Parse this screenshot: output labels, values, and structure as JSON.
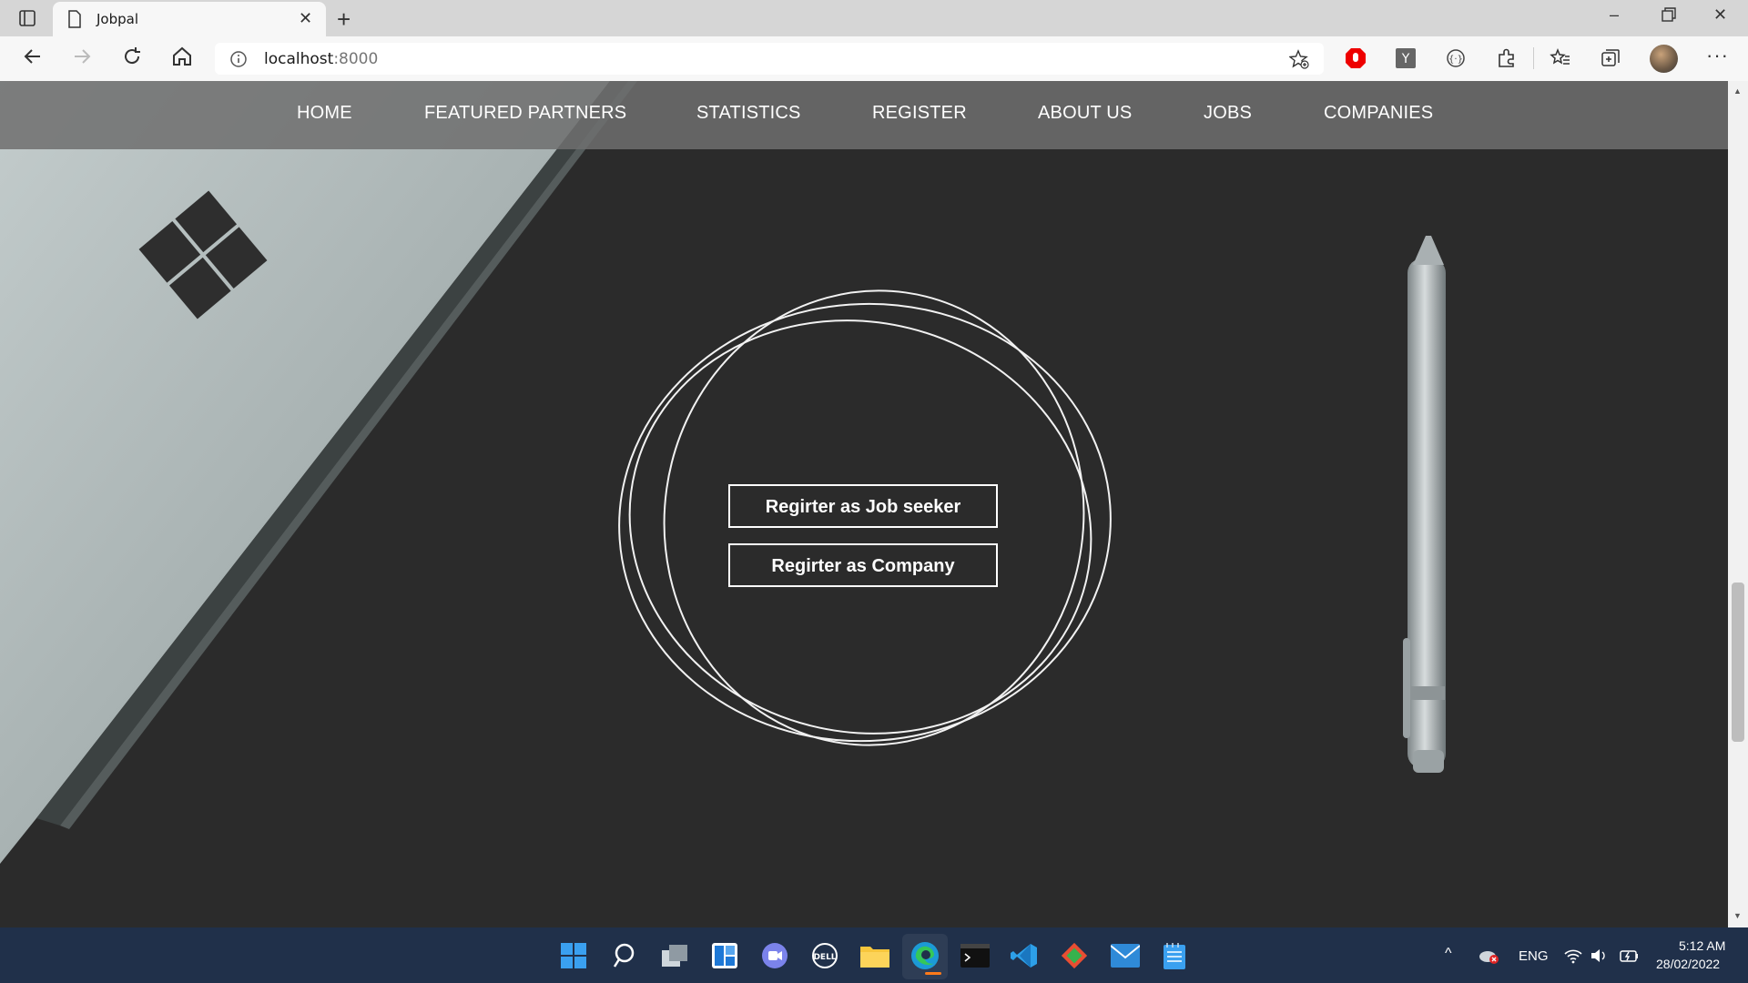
{
  "browser": {
    "tab_title": "Jobpal",
    "url_host": "localhost",
    "url_port": ":8000"
  },
  "nav": {
    "items": [
      "HOME",
      "FEATURED PARTNERS",
      "STATISTICS",
      "REGISTER",
      "ABOUT US",
      "JOBS",
      "COMPANIES"
    ]
  },
  "register": {
    "job_seeker_label": "Regirter as Job seeker",
    "company_label": "Regirter as Company"
  },
  "taskbar": {
    "language": "ENG",
    "time": "5:12 AM",
    "date": "28/02/2022"
  },
  "colors": {
    "nav_bg": "#6e6e6e",
    "page_bg": "#2a2a2a",
    "taskbar_bg": "#20304a",
    "edge_accent": "#0078d4"
  }
}
